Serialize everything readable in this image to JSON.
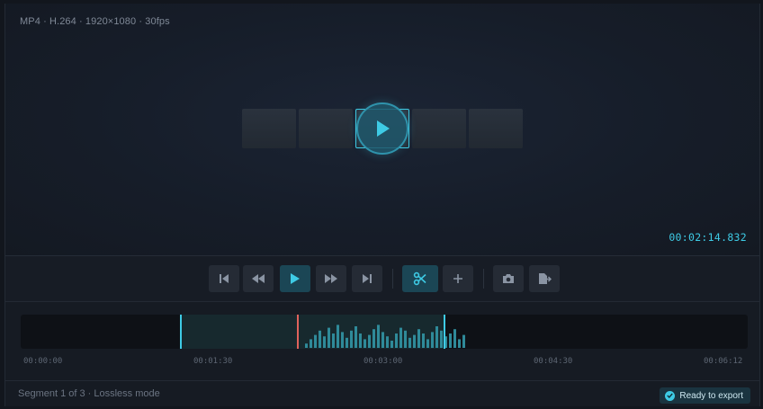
{
  "player": {
    "meta": "MP4 · H.264 · 1920×1080 · 30fps",
    "timecode": "00:02:14.832"
  },
  "controls": [
    {
      "id": "skip-start",
      "icon": "skip-back-icon"
    },
    {
      "id": "rewind",
      "icon": "rewind-icon"
    },
    {
      "id": "play",
      "icon": "play-icon",
      "active": true
    },
    {
      "id": "fast-forward",
      "icon": "fast-forward-icon"
    },
    {
      "id": "skip-end",
      "icon": "skip-forward-icon"
    },
    {
      "id": "cut",
      "icon": "scissors-icon",
      "active": true
    },
    {
      "id": "add",
      "icon": "plus-icon"
    },
    {
      "id": "snapshot",
      "icon": "camera-icon"
    },
    {
      "id": "export",
      "icon": "export-file-icon"
    }
  ],
  "timeline": {
    "ticks": [
      "00:00:00",
      "00:01:30",
      "00:03:00",
      "00:04:30",
      "00:06:12"
    ],
    "waveform": [
      0.15,
      0.3,
      0.45,
      0.6,
      0.4,
      0.7,
      0.5,
      0.8,
      0.55,
      0.35,
      0.6,
      0.75,
      0.5,
      0.3,
      0.45,
      0.65,
      0.8,
      0.55,
      0.4,
      0.25,
      0.5,
      0.7,
      0.6,
      0.35,
      0.45,
      0.65,
      0.5,
      0.3,
      0.55,
      0.75,
      0.6,
      0.4,
      0.5,
      0.65,
      0.3,
      0.45
    ]
  },
  "status": {
    "text": "Segment 1 of 3 · Lossless mode",
    "badge": "Ready to export"
  },
  "colors": {
    "accent": "#3ecbe5",
    "playhead": "#e0625c",
    "waveform": "#2f8a99"
  }
}
